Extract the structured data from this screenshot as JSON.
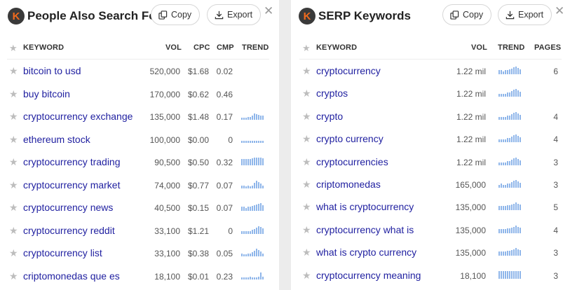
{
  "left": {
    "title": "People Also Search For",
    "copy_label": "Copy",
    "export_label": "Export",
    "close_glyph": "✕",
    "headers": {
      "keyword": "KEYWORD",
      "vol": "VOL",
      "cpc": "CPC",
      "cmp": "CMP",
      "trend": "TREND"
    },
    "rows": [
      {
        "keyword": "bitcoin to usd",
        "vol": "520,000",
        "cpc": "$1.68",
        "cmp": "0.02",
        "trend": []
      },
      {
        "keyword": "buy bitcoin",
        "vol": "170,000",
        "cpc": "$0.62",
        "cmp": "0.46",
        "trend": []
      },
      {
        "keyword": "cryptocurrency exchange",
        "vol": "135,000",
        "cpc": "$1.48",
        "cmp": "0.17",
        "trend": [
          3,
          3,
          3,
          4,
          4,
          5,
          8,
          7,
          6,
          5,
          5
        ]
      },
      {
        "keyword": "ethereum stock",
        "vol": "100,000",
        "cpc": "$0.00",
        "cmp": "0",
        "trend": [
          3,
          3,
          3,
          3,
          3,
          3,
          3,
          3,
          3,
          3,
          3
        ]
      },
      {
        "keyword": "cryptocurrency trading",
        "vol": "90,500",
        "cpc": "$0.50",
        "cmp": "0.32",
        "trend": [
          8,
          8,
          8,
          8,
          8,
          9,
          10,
          10,
          10,
          10,
          9
        ]
      },
      {
        "keyword": "cryptocurrency market",
        "vol": "74,000",
        "cpc": "$0.77",
        "cmp": "0.07",
        "trend": [
          4,
          4,
          3,
          4,
          3,
          4,
          7,
          10,
          8,
          6,
          4
        ]
      },
      {
        "keyword": "cryptocurrency news",
        "vol": "40,500",
        "cpc": "$0.15",
        "cmp": "0.07",
        "trend": [
          5,
          5,
          4,
          5,
          5,
          6,
          7,
          8,
          9,
          10,
          7
        ]
      },
      {
        "keyword": "cryptocurrency reddit",
        "vol": "33,100",
        "cpc": "$1.21",
        "cmp": "0",
        "trend": [
          4,
          4,
          4,
          4,
          4,
          5,
          6,
          8,
          10,
          9,
          7
        ]
      },
      {
        "keyword": "cryptocurrency list",
        "vol": "33,100",
        "cpc": "$0.38",
        "cmp": "0.05",
        "trend": [
          4,
          3,
          3,
          4,
          4,
          5,
          7,
          10,
          8,
          6,
          4
        ]
      },
      {
        "keyword": "criptomonedas que es",
        "vol": "18,100",
        "cpc": "$0.01",
        "cmp": "0.23",
        "trend": [
          3,
          3,
          3,
          3,
          4,
          3,
          3,
          3,
          4,
          9,
          4
        ]
      }
    ]
  },
  "right": {
    "title": "SERP Keywords",
    "copy_label": "Copy",
    "export_label": "Export",
    "close_glyph": "✕",
    "headers": {
      "keyword": "KEYWORD",
      "vol": "VOL",
      "trend": "TREND",
      "pages": "PAGES"
    },
    "rows": [
      {
        "keyword": "cryptocurrency",
        "vol": "1.22 mil",
        "pages": "6",
        "trend": [
          5,
          5,
          4,
          5,
          5,
          6,
          7,
          9,
          10,
          8,
          6
        ]
      },
      {
        "keyword": "cryptos",
        "vol": "1.22 mil",
        "pages": "",
        "trend": [
          4,
          4,
          4,
          4,
          5,
          5,
          7,
          9,
          10,
          8,
          6
        ]
      },
      {
        "keyword": "crypto",
        "vol": "1.22 mil",
        "pages": "4",
        "trend": [
          4,
          4,
          4,
          4,
          5,
          5,
          7,
          9,
          10,
          8,
          6
        ]
      },
      {
        "keyword": "crypto currency",
        "vol": "1.22 mil",
        "pages": "4",
        "trend": [
          4,
          4,
          4,
          4,
          5,
          5,
          7,
          9,
          10,
          8,
          6
        ]
      },
      {
        "keyword": "cryptocurrencies",
        "vol": "1.22 mil",
        "pages": "3",
        "trend": [
          4,
          4,
          4,
          4,
          5,
          5,
          7,
          9,
          10,
          8,
          6
        ]
      },
      {
        "keyword": "criptomonedas",
        "vol": "165,000",
        "pages": "3",
        "trend": [
          4,
          5,
          4,
          4,
          5,
          5,
          7,
          9,
          10,
          8,
          6
        ]
      },
      {
        "keyword": "what is cryptocurrency",
        "vol": "135,000",
        "pages": "5",
        "trend": [
          5,
          5,
          5,
          5,
          6,
          6,
          7,
          8,
          10,
          8,
          7
        ]
      },
      {
        "keyword": "cryptocurrency what is",
        "vol": "135,000",
        "pages": "4",
        "trend": [
          5,
          5,
          5,
          5,
          6,
          6,
          7,
          8,
          10,
          8,
          7
        ]
      },
      {
        "keyword": "what is crypto currency",
        "vol": "135,000",
        "pages": "3",
        "trend": [
          5,
          5,
          5,
          5,
          6,
          6,
          7,
          8,
          10,
          8,
          7
        ]
      },
      {
        "keyword": "cryptocurrency meaning",
        "vol": "18,100",
        "pages": "3",
        "trend": [
          10,
          10,
          10,
          10,
          10,
          10,
          10,
          10,
          10,
          10,
          10
        ]
      }
    ]
  }
}
